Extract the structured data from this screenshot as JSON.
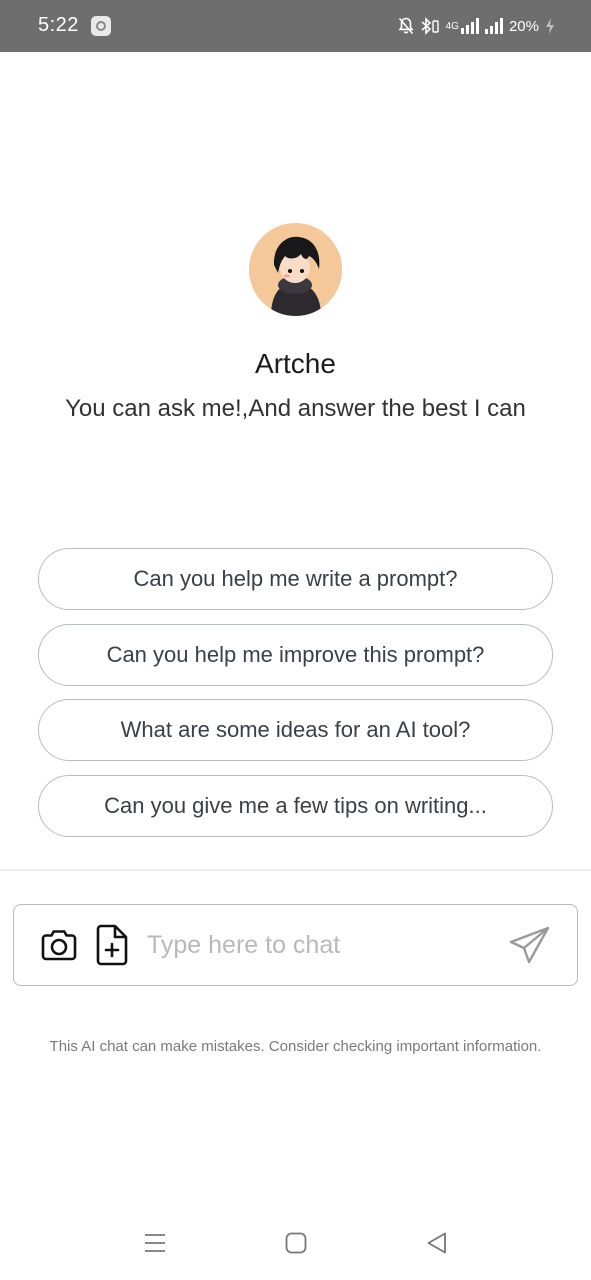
{
  "status_bar": {
    "time": "5:22",
    "network": "4G",
    "battery": "20%"
  },
  "bot": {
    "name": "Artche",
    "description": "You can ask me!,And answer the best I can",
    "avatar_icon": "anime-character-avatar"
  },
  "suggestions": [
    "Can you help me write a prompt?",
    "Can you help me improve this prompt?",
    "What are some ideas for an AI tool?",
    "Can you give me a few tips on writing..."
  ],
  "input": {
    "placeholder": "Type here to chat",
    "value": ""
  },
  "disclaimer": "This AI chat can make mistakes. Consider checking important information.",
  "nav_bar": {
    "icons": [
      "menu-icon",
      "home-icon",
      "back-icon"
    ]
  },
  "colors": {
    "status_bar_bg": "#6e6e6e",
    "avatar_bg": "#f5c89a",
    "border": "#b8bdc2"
  }
}
